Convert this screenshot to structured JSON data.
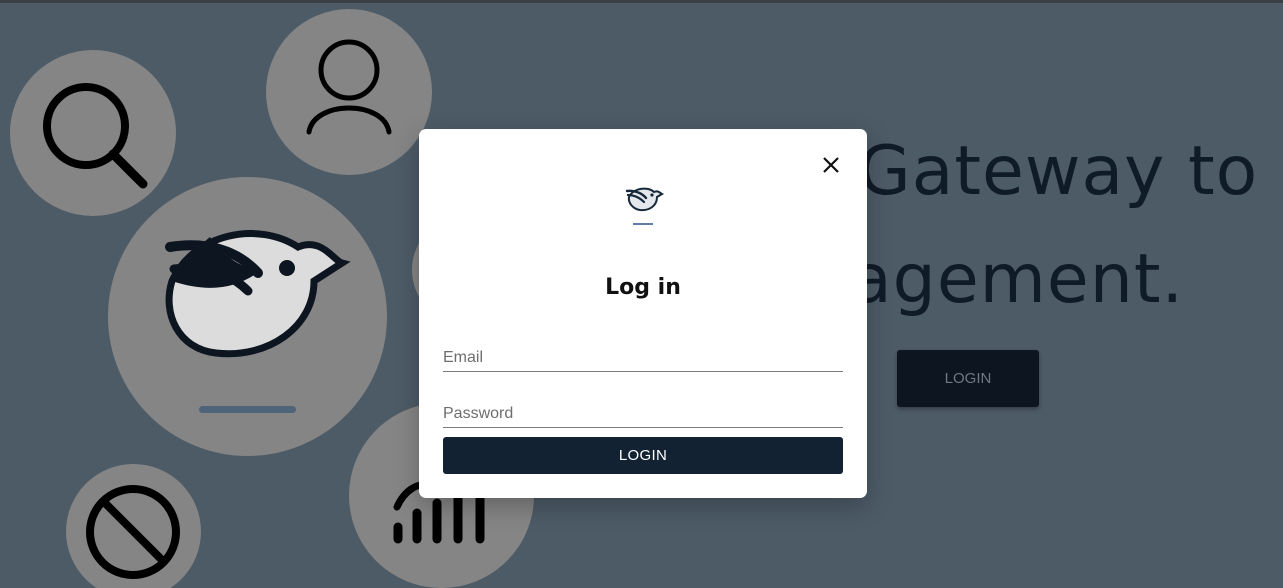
{
  "hero": {
    "line1": "Gateway to",
    "line2": "agement.",
    "login_label": "LOGIN"
  },
  "modal": {
    "title": "Log in",
    "email_placeholder": "Email",
    "password_placeholder": "Password",
    "submit_label": "LOGIN",
    "close_icon": "close-icon",
    "logo_icon": "bird-logo-icon"
  },
  "background_icons": [
    "search-icon",
    "user-icon",
    "bird-logo-icon",
    "block-icon",
    "signal-bars-icon"
  ],
  "colors": {
    "overlay_bg": "#4d5b67",
    "bubble": "#858585",
    "primary_button": "#122233",
    "hero_text": "#101b28"
  }
}
